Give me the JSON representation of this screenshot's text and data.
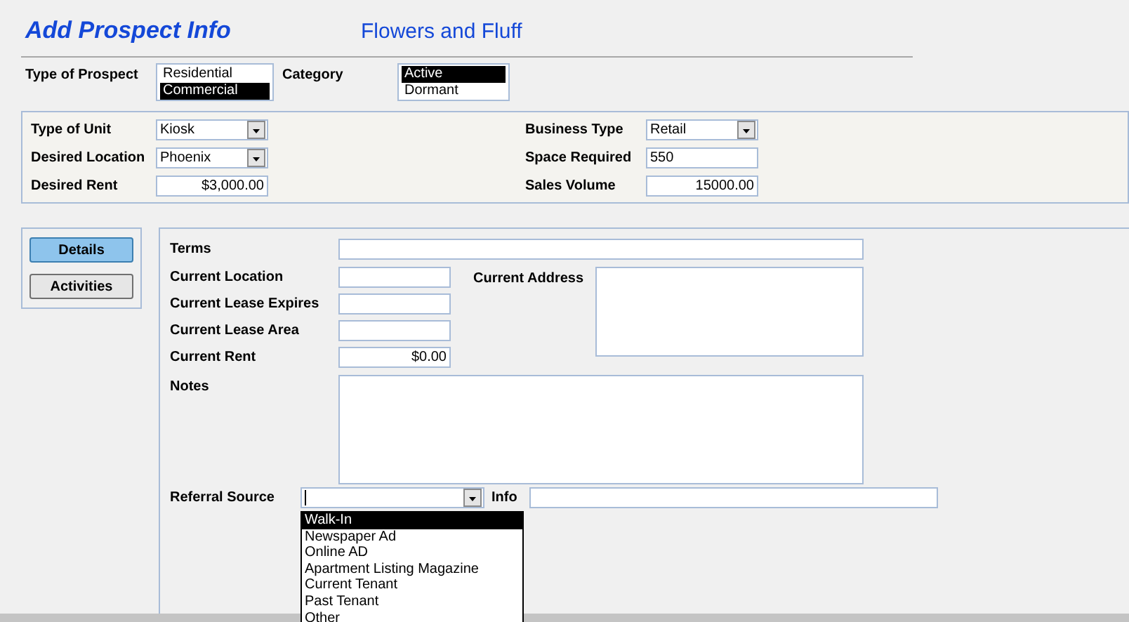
{
  "window": {
    "title": "Add Prospect Info",
    "company": "Flowers and Fluff"
  },
  "prospect": {
    "label": "Type of Prospect",
    "options": [
      {
        "label": "Residential",
        "selected": false
      },
      {
        "label": "Commercial",
        "selected": true
      }
    ]
  },
  "category": {
    "label": "Category",
    "options": [
      {
        "label": "Active",
        "selected": true
      },
      {
        "label": "Dormant",
        "selected": false
      }
    ]
  },
  "unit_fields_left": [
    {
      "label": "Type of Unit",
      "kind": "combo",
      "value": "Kiosk"
    },
    {
      "label": "Desired Location",
      "kind": "combo",
      "value": "Phoenix"
    },
    {
      "label": "Desired Rent",
      "kind": "amount",
      "value": "$3,000.00"
    }
  ],
  "unit_fields_right": [
    {
      "label": "Business Type",
      "kind": "combo",
      "value": "Retail"
    },
    {
      "label": "Space Required",
      "kind": "text",
      "value": "550"
    },
    {
      "label": "Sales Volume",
      "kind": "amount",
      "value": "15000.00"
    }
  ],
  "tabs": [
    {
      "label": "Details",
      "selected": true
    },
    {
      "label": "Activities",
      "selected": false
    }
  ],
  "details": {
    "terms": {
      "label": "Terms"
    },
    "fields": [
      {
        "label": "Current Location"
      },
      {
        "label": "Current Lease Expires"
      },
      {
        "label": "Current Lease Area"
      },
      {
        "label": "Current Rent",
        "value": "$0.00"
      }
    ],
    "address": {
      "label": "Current Address"
    },
    "notes": {
      "label": "Notes"
    },
    "referral": {
      "label": "Referral Source",
      "info_label": "Info",
      "options": [
        {
          "label": "Walk-In",
          "selected": true
        },
        {
          "label": "Newspaper Ad",
          "selected": false
        },
        {
          "label": "Online AD",
          "selected": false
        },
        {
          "label": "Apartment Listing Magazine",
          "selected": false
        },
        {
          "label": "Current Tenant",
          "selected": false
        },
        {
          "label": "Past Tenant",
          "selected": false
        },
        {
          "label": "Other",
          "selected": false
        }
      ]
    }
  }
}
